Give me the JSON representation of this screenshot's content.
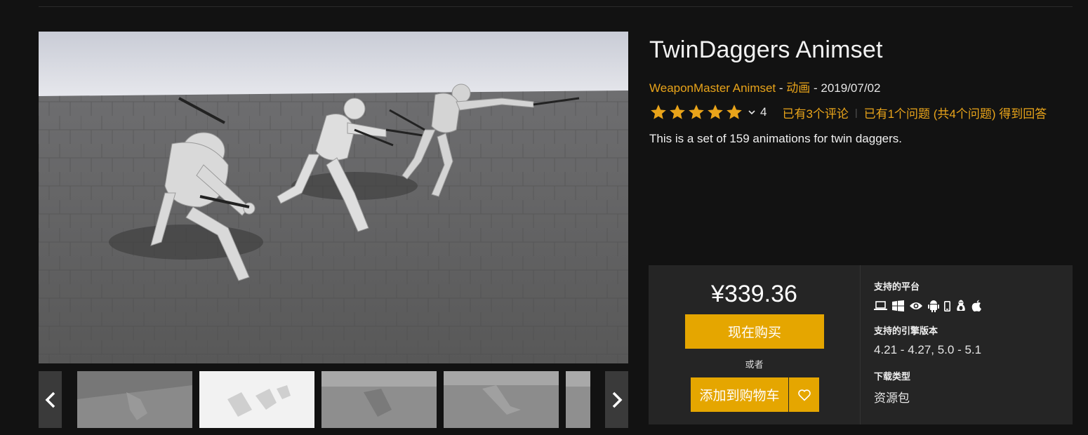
{
  "product": {
    "title": "TwinDaggers Animset",
    "seller": "WeaponMaster Animset",
    "meta_sep1": " - ",
    "category": "动画",
    "meta_sep2": " - ",
    "date": "2019/07/02",
    "rating": 5,
    "rating_count": "4",
    "reviews_link": "已有3个评论",
    "questions_link": "已有1个问题 (共4个问题) 得到回答",
    "description": "This is a set of 159 animations for twin daggers."
  },
  "gallery": {
    "main_image": "robot-mannequins-with-twin-daggers",
    "thumbnails": [
      "thumb-1",
      "thumb-2",
      "thumb-3",
      "thumb-4",
      "thumb-5"
    ],
    "prev_icon": "chevron-left-icon",
    "next_icon": "chevron-right-icon"
  },
  "purchase": {
    "price": "¥339.36",
    "buy_now": "现在购买",
    "or": "或者",
    "add_to_cart": "添加到购物车",
    "wishlist_icon": "heart-icon"
  },
  "info": {
    "platforms_label": "支持的平台",
    "platform_icons": [
      "laptop-icon",
      "windows-icon",
      "eye-icon",
      "android-icon",
      "phone-icon",
      "linux-icon",
      "apple-icon"
    ],
    "engine_label": "支持的引擎版本",
    "engine_versions": "4.21 - 4.27, 5.0 - 5.1",
    "download_label": "下载类型",
    "download_type": "资源包"
  },
  "colors": {
    "accent": "#e9a41a",
    "button": "#e5a600",
    "background": "#121212",
    "panel": "#252525"
  }
}
